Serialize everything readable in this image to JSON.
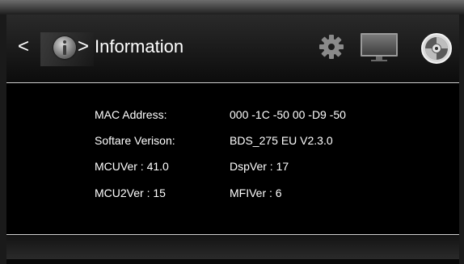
{
  "header": {
    "back_chevron": "<",
    "forward_chevron": ">",
    "title": "Information",
    "icons": {
      "info": "info-icon",
      "settings": "gear-icon",
      "display": "monitor-icon",
      "disc": "disc-icon"
    }
  },
  "info_rows": [
    {
      "label": "MAC Address:",
      "value": "000 -1C -50 00 -D9 -50"
    },
    {
      "label": "Softare Verison:",
      "value": "BDS_275 EU V2.3.0"
    },
    {
      "label": "MCUVer : 41.0",
      "value": "DspVer : 17"
    },
    {
      "label": "MCU2Ver : 15",
      "value": "MFIVer : 6"
    }
  ],
  "colors": {
    "background": "#000000",
    "text": "#ffffff",
    "divider": "#cfcfcf",
    "icon_gray": "#8a8a8a"
  }
}
